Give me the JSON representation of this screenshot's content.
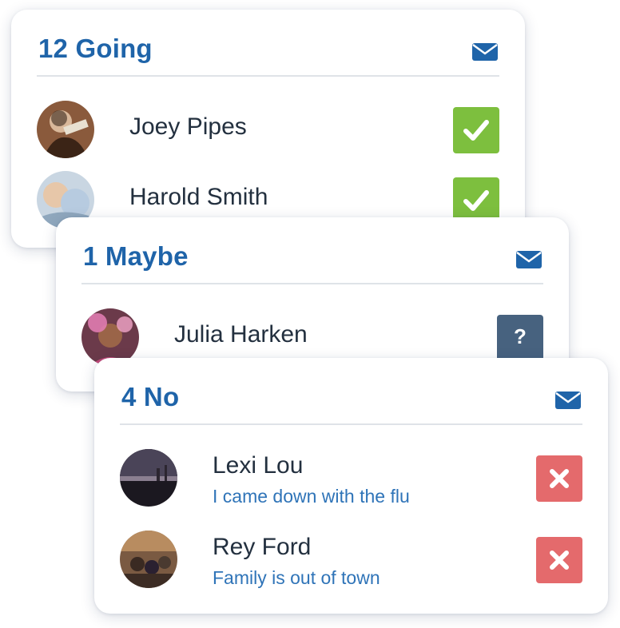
{
  "colors": {
    "title": "#1f64a9",
    "going": "#7dbf3e",
    "maybe": "#47627f",
    "no": "#e46a6c",
    "note": "#2f74b8"
  },
  "going": {
    "title": "12 Going",
    "icon": "mail-icon",
    "people": [
      {
        "name": "Joey Pipes",
        "status_icon": "check-icon"
      },
      {
        "name": "Harold Smith",
        "status_icon": "check-icon"
      }
    ]
  },
  "maybe": {
    "title": "1 Maybe",
    "icon": "mail-icon",
    "people": [
      {
        "name": "Julia Harken",
        "status_label": "?"
      }
    ]
  },
  "no": {
    "title": "4 No",
    "icon": "mail-icon",
    "people": [
      {
        "name": "Lexi Lou",
        "note": "I came down with the flu",
        "status_icon": "x-icon"
      },
      {
        "name": "Rey Ford",
        "note": "Family is out of town",
        "status_icon": "x-icon"
      }
    ]
  }
}
